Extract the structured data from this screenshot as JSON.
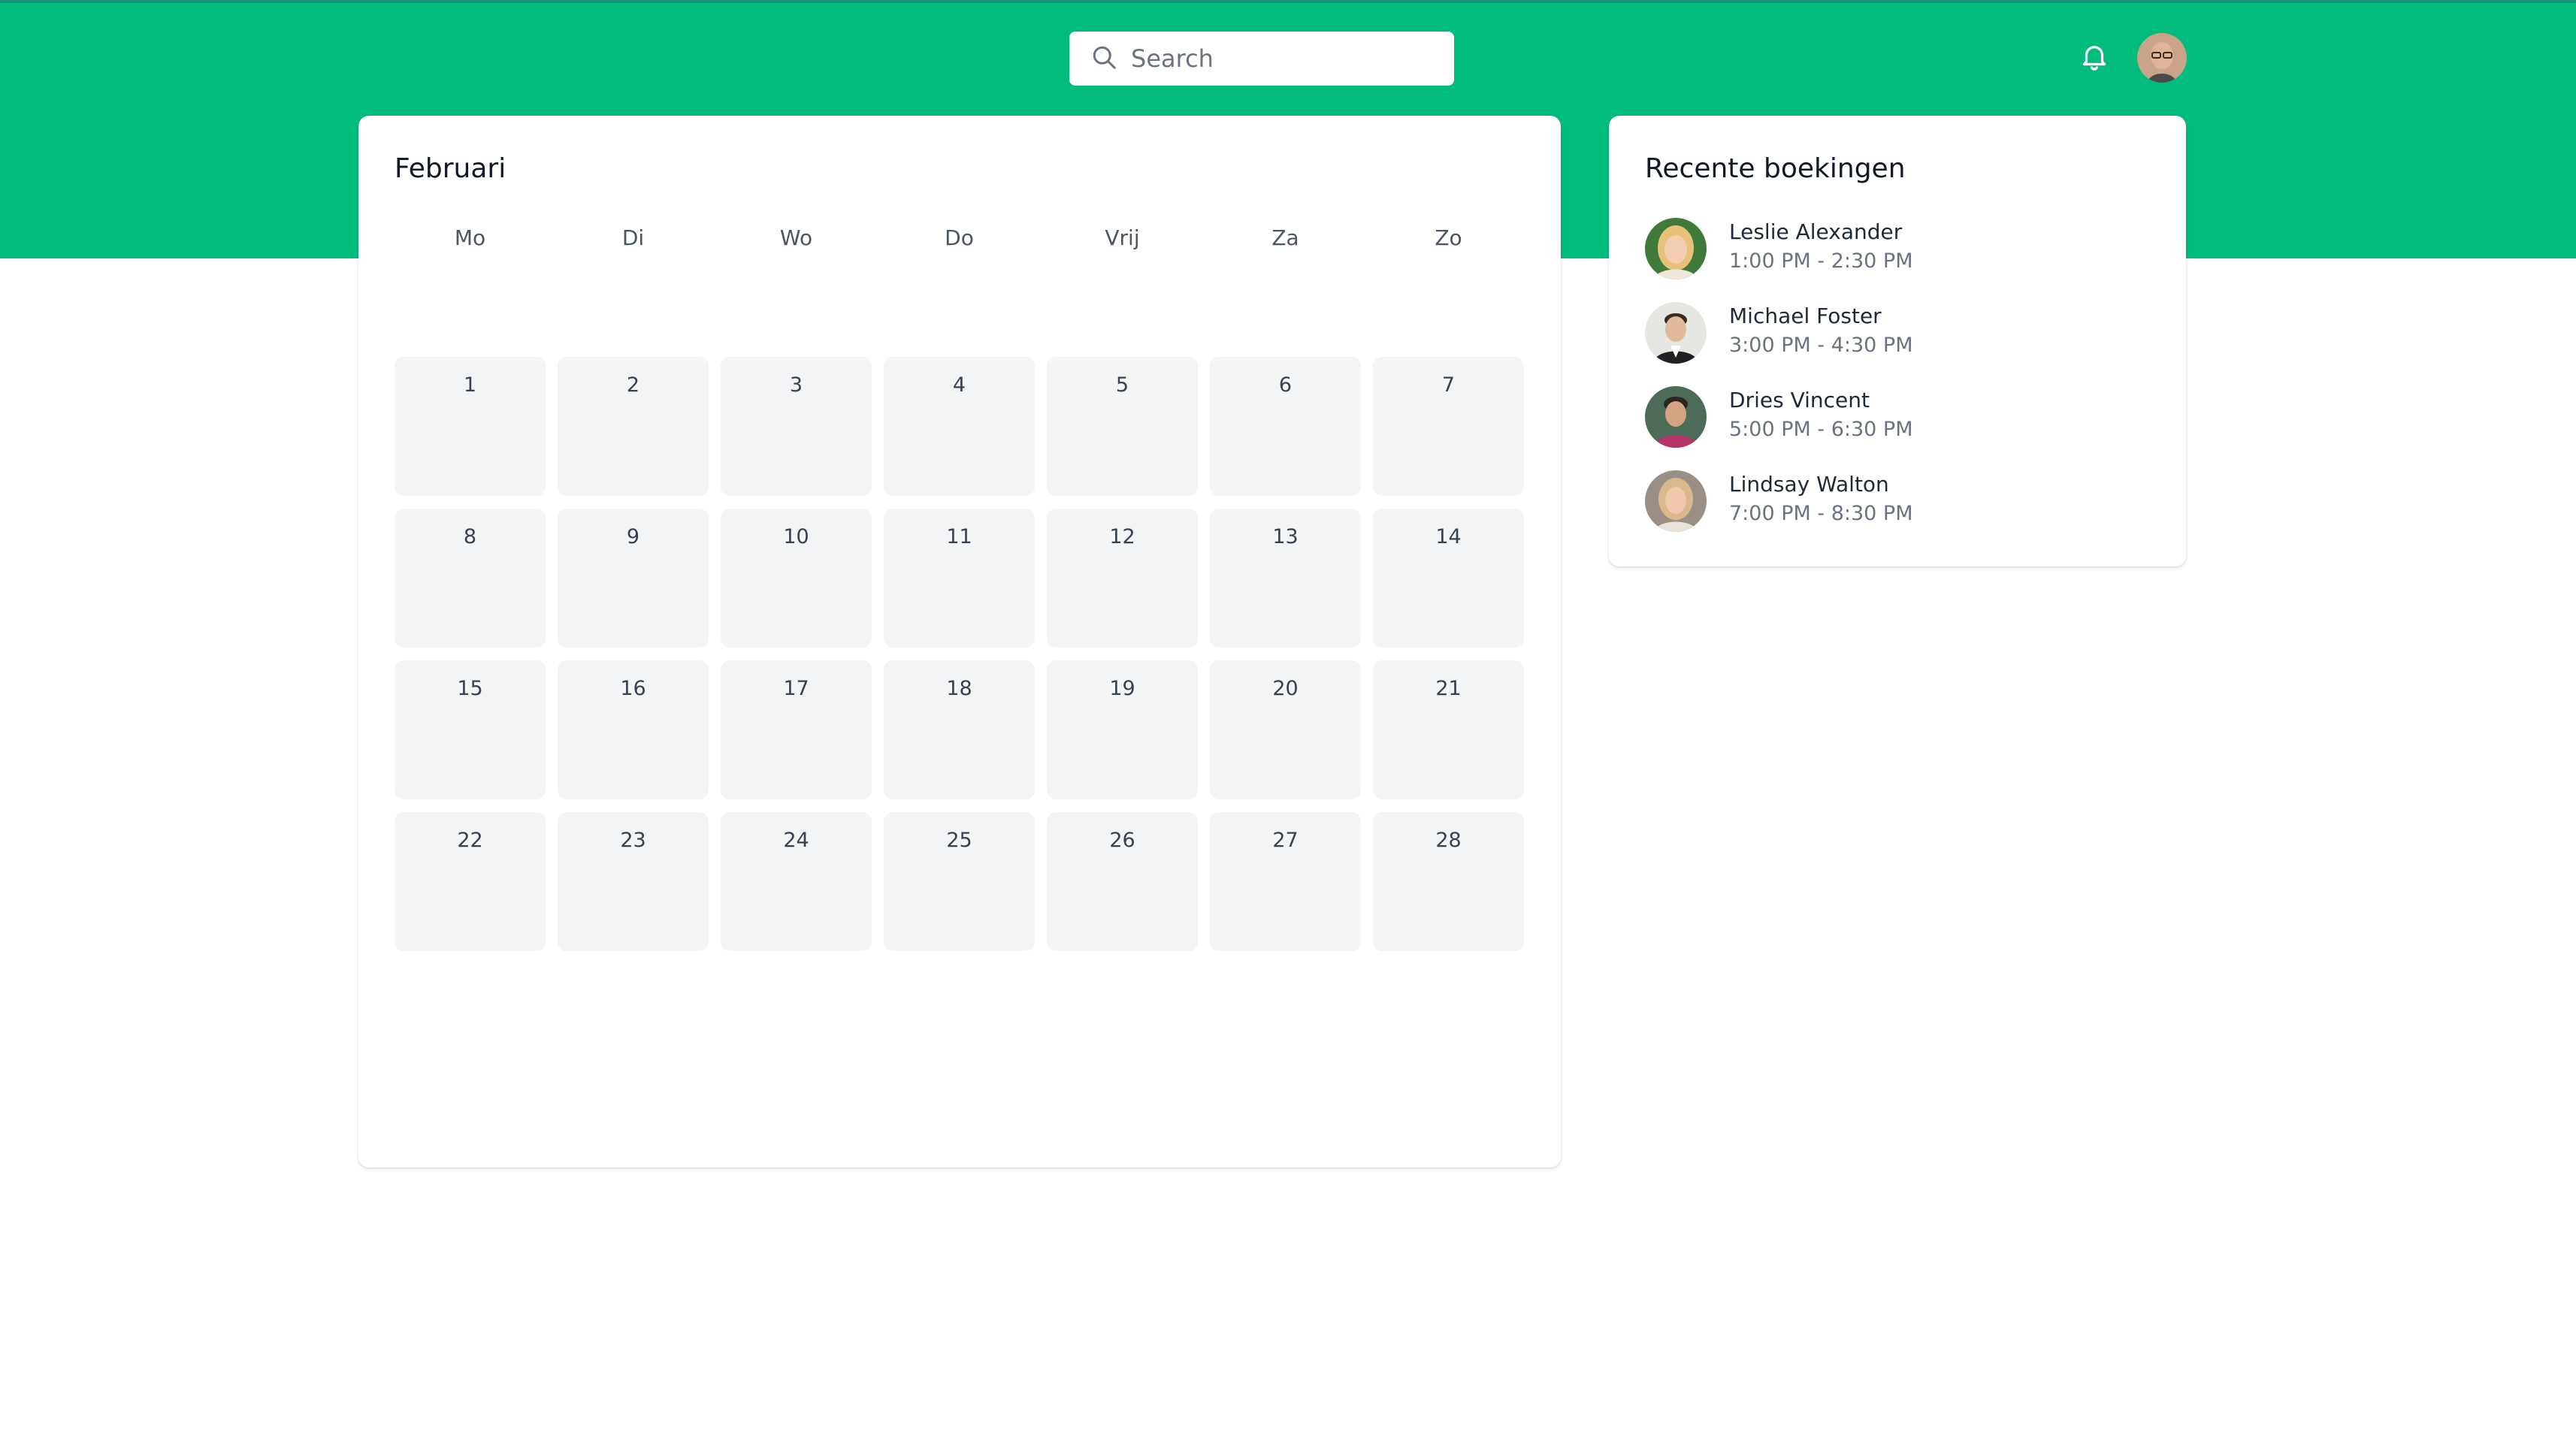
{
  "header": {
    "search": {
      "placeholder": "Search"
    },
    "icons": {
      "notifications": "bell-icon",
      "search": "search-icon",
      "user": "user-avatar"
    }
  },
  "calendar": {
    "month": "Februari",
    "weekdays": [
      "Mo",
      "Di",
      "Wo",
      "Do",
      "Vrij",
      "Za",
      "Zo"
    ],
    "days": [
      "1",
      "2",
      "3",
      "4",
      "5",
      "6",
      "7",
      "8",
      "9",
      "10",
      "11",
      "12",
      "13",
      "14",
      "15",
      "16",
      "17",
      "18",
      "19",
      "20",
      "21",
      "22",
      "23",
      "24",
      "25",
      "26",
      "27",
      "28"
    ]
  },
  "bookings": {
    "title": "Recente boekingen",
    "items": [
      {
        "name": "Leslie Alexander",
        "time": "1:00 PM - 2:30 PM"
      },
      {
        "name": "Michael Foster",
        "time": "3:00 PM - 4:30 PM"
      },
      {
        "name": "Dries Vincent",
        "time": "5:00 PM - 6:30 PM"
      },
      {
        "name": "Lindsay Walton",
        "time": "7:00 PM - 8:30 PM"
      }
    ]
  },
  "colors": {
    "brand": "#02bc7d",
    "day_cell": "#f3f4f6"
  }
}
